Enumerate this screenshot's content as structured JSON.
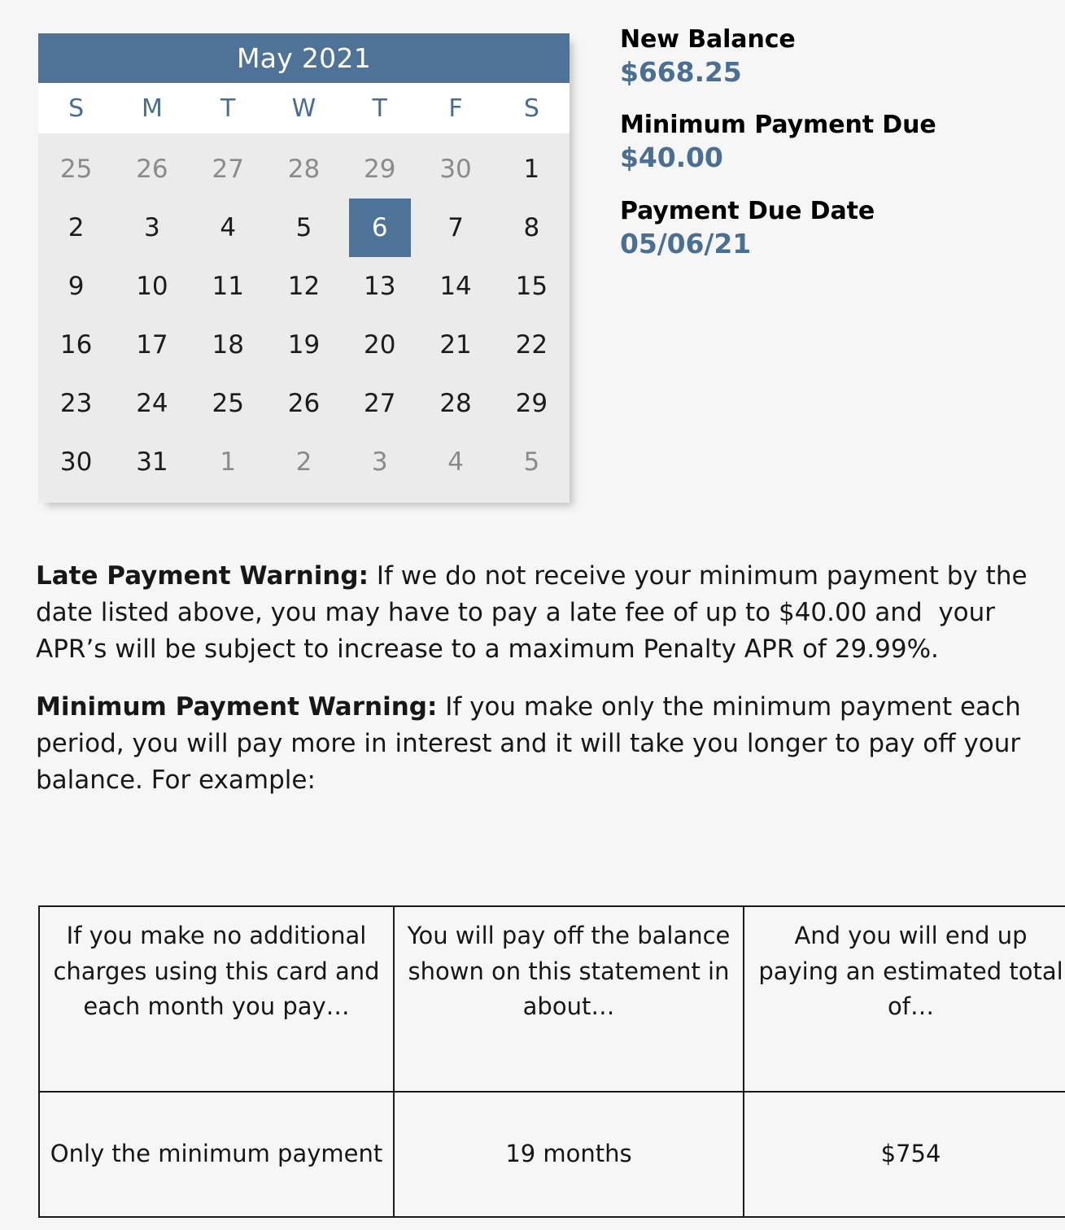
{
  "calendar": {
    "title": "May 2021",
    "weekday_headers": [
      "S",
      "M",
      "T",
      "W",
      "T",
      "F",
      "S"
    ],
    "selected_day": 6,
    "weeks": [
      [
        {
          "n": "25",
          "muted": true
        },
        {
          "n": "26",
          "muted": true
        },
        {
          "n": "27",
          "muted": true
        },
        {
          "n": "28",
          "muted": true
        },
        {
          "n": "29",
          "muted": true
        },
        {
          "n": "30",
          "muted": true
        },
        {
          "n": "1",
          "muted": false
        }
      ],
      [
        {
          "n": "2",
          "muted": false
        },
        {
          "n": "3",
          "muted": false
        },
        {
          "n": "4",
          "muted": false
        },
        {
          "n": "5",
          "muted": false
        },
        {
          "n": "6",
          "muted": false,
          "selected": true
        },
        {
          "n": "7",
          "muted": false
        },
        {
          "n": "8",
          "muted": false
        }
      ],
      [
        {
          "n": "9",
          "muted": false
        },
        {
          "n": "10",
          "muted": false
        },
        {
          "n": "11",
          "muted": false
        },
        {
          "n": "12",
          "muted": false
        },
        {
          "n": "13",
          "muted": false
        },
        {
          "n": "14",
          "muted": false
        },
        {
          "n": "15",
          "muted": false
        }
      ],
      [
        {
          "n": "16",
          "muted": false
        },
        {
          "n": "17",
          "muted": false
        },
        {
          "n": "18",
          "muted": false
        },
        {
          "n": "19",
          "muted": false
        },
        {
          "n": "20",
          "muted": false
        },
        {
          "n": "21",
          "muted": false
        },
        {
          "n": "22",
          "muted": false
        }
      ],
      [
        {
          "n": "23",
          "muted": false
        },
        {
          "n": "24",
          "muted": false
        },
        {
          "n": "25",
          "muted": false
        },
        {
          "n": "26",
          "muted": false
        },
        {
          "n": "27",
          "muted": false
        },
        {
          "n": "28",
          "muted": false
        },
        {
          "n": "29",
          "muted": false
        }
      ],
      [
        {
          "n": "30",
          "muted": false
        },
        {
          "n": "31",
          "muted": false
        },
        {
          "n": "1",
          "muted": true
        },
        {
          "n": "2",
          "muted": true
        },
        {
          "n": "3",
          "muted": true
        },
        {
          "n": "4",
          "muted": true
        },
        {
          "n": "5",
          "muted": true
        }
      ]
    ]
  },
  "summary": {
    "new_balance_label": "New Balance",
    "new_balance_value": "$668.25",
    "minimum_payment_label": "Minimum Payment Due",
    "minimum_payment_value": "$40.00",
    "due_date_label": "Payment Due Date",
    "due_date_value": "05/06/21"
  },
  "warnings": {
    "late_payment_heading": "Late Payment Warning:",
    "late_payment_body": " If we do not receive your minimum payment by the date listed above, you may have to pay a late fee of up to $40.00 and  your APR’s will be subject to increase to a maximum Penalty APR of 29.99%.",
    "minimum_payment_heading": "Minimum Payment Warning:",
    "minimum_payment_body": " If you make only the minimum payment each period, you will pay more in interest and it will take you longer to pay off your balance. For example:"
  },
  "example_table": {
    "headers": [
      "If you make no additional charges using this card and each month you pay…",
      "You will pay off the balance shown on this statement in about…",
      "And you will end up paying an estimated total of…"
    ],
    "rows": [
      [
        "Only the minimum payment",
        "19 months",
        "$754"
      ]
    ]
  },
  "colors": {
    "accent_blue": "#4F7299",
    "value_blue": "#4B6E93",
    "page_background": "#F6F6F6",
    "calendar_body": "#EBEBEB"
  }
}
